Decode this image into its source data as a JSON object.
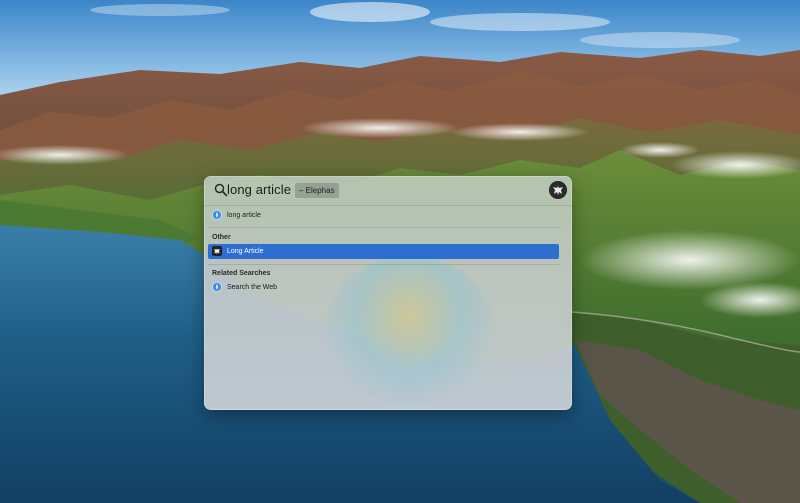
{
  "search": {
    "query": "long article",
    "suggestion": "– Elephas",
    "icon": "magnifying-glass-icon"
  },
  "top_hit": {
    "label": "long article",
    "icon": "safari-compass-icon"
  },
  "sections": {
    "other": {
      "header": "Other",
      "items": [
        {
          "label": "Long Article",
          "icon": "elephas-app-icon",
          "selected": true
        }
      ]
    },
    "related": {
      "header": "Related Searches",
      "items": [
        {
          "label": "Search the Web",
          "icon": "safari-compass-icon"
        }
      ]
    }
  },
  "colors": {
    "selection": "#2d6fd0",
    "panel": "#c8cfca"
  }
}
